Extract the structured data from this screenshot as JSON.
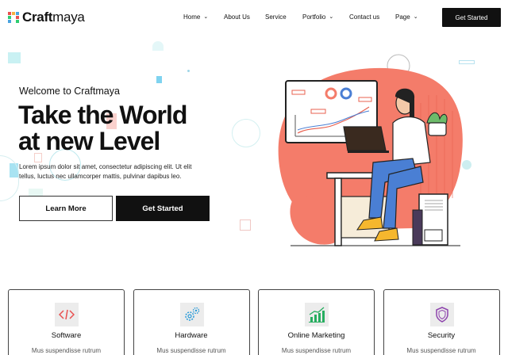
{
  "brand": {
    "name_bold": "Craft",
    "name_rest": "maya",
    "logo_colors": [
      "#e94f4f",
      "#f5b041",
      "#4aa3df",
      "#2ecc71",
      "#9b59b6",
      "#e94f4f",
      "#4aa3df",
      "#f5b041",
      "#2ecc71"
    ]
  },
  "nav": {
    "items": [
      {
        "label": "Home",
        "icon": "chevron-down-icon"
      },
      {
        "label": "About Us"
      },
      {
        "label": "Service"
      },
      {
        "label": "Portfolio",
        "icon": "chevron-down-icon"
      },
      {
        "label": "Contact us"
      },
      {
        "label": "Page",
        "icon": "chevron-down-icon"
      }
    ],
    "cta_label": "Get Started"
  },
  "hero": {
    "eyebrow": "Welcome to Craftmaya",
    "title_line1": "Take the World",
    "title_line2": "at new Level",
    "description": "Lorem ipsum dolor sit amet, consectetur adipiscing elit. Ut elit tellus, luctus nec ullamcorper mattis, pulvinar dapibus leo.",
    "primary_button": "Learn More",
    "secondary_button": "Get Started"
  },
  "features": [
    {
      "title": "Software",
      "description": "Mus suspendisse rutrum",
      "icon": "code-icon",
      "accent": "#e94f4f"
    },
    {
      "title": "Hardware",
      "description": "Mus suspendisse rutrum",
      "icon": "gears-icon",
      "accent": "#2a9bd8"
    },
    {
      "title": "Online Marketing",
      "description": "Mus suspendisse rutrum",
      "icon": "growth-chart-icon",
      "accent": "#27ae60"
    },
    {
      "title": "Security",
      "description": "Mus suspendisse rutrum",
      "icon": "shield-icon",
      "accent": "#8e44ad"
    }
  ],
  "colors": {
    "accent_coral": "#f47c6a",
    "primary_dark": "#111111",
    "deco_cyan": "#bfeef0"
  }
}
